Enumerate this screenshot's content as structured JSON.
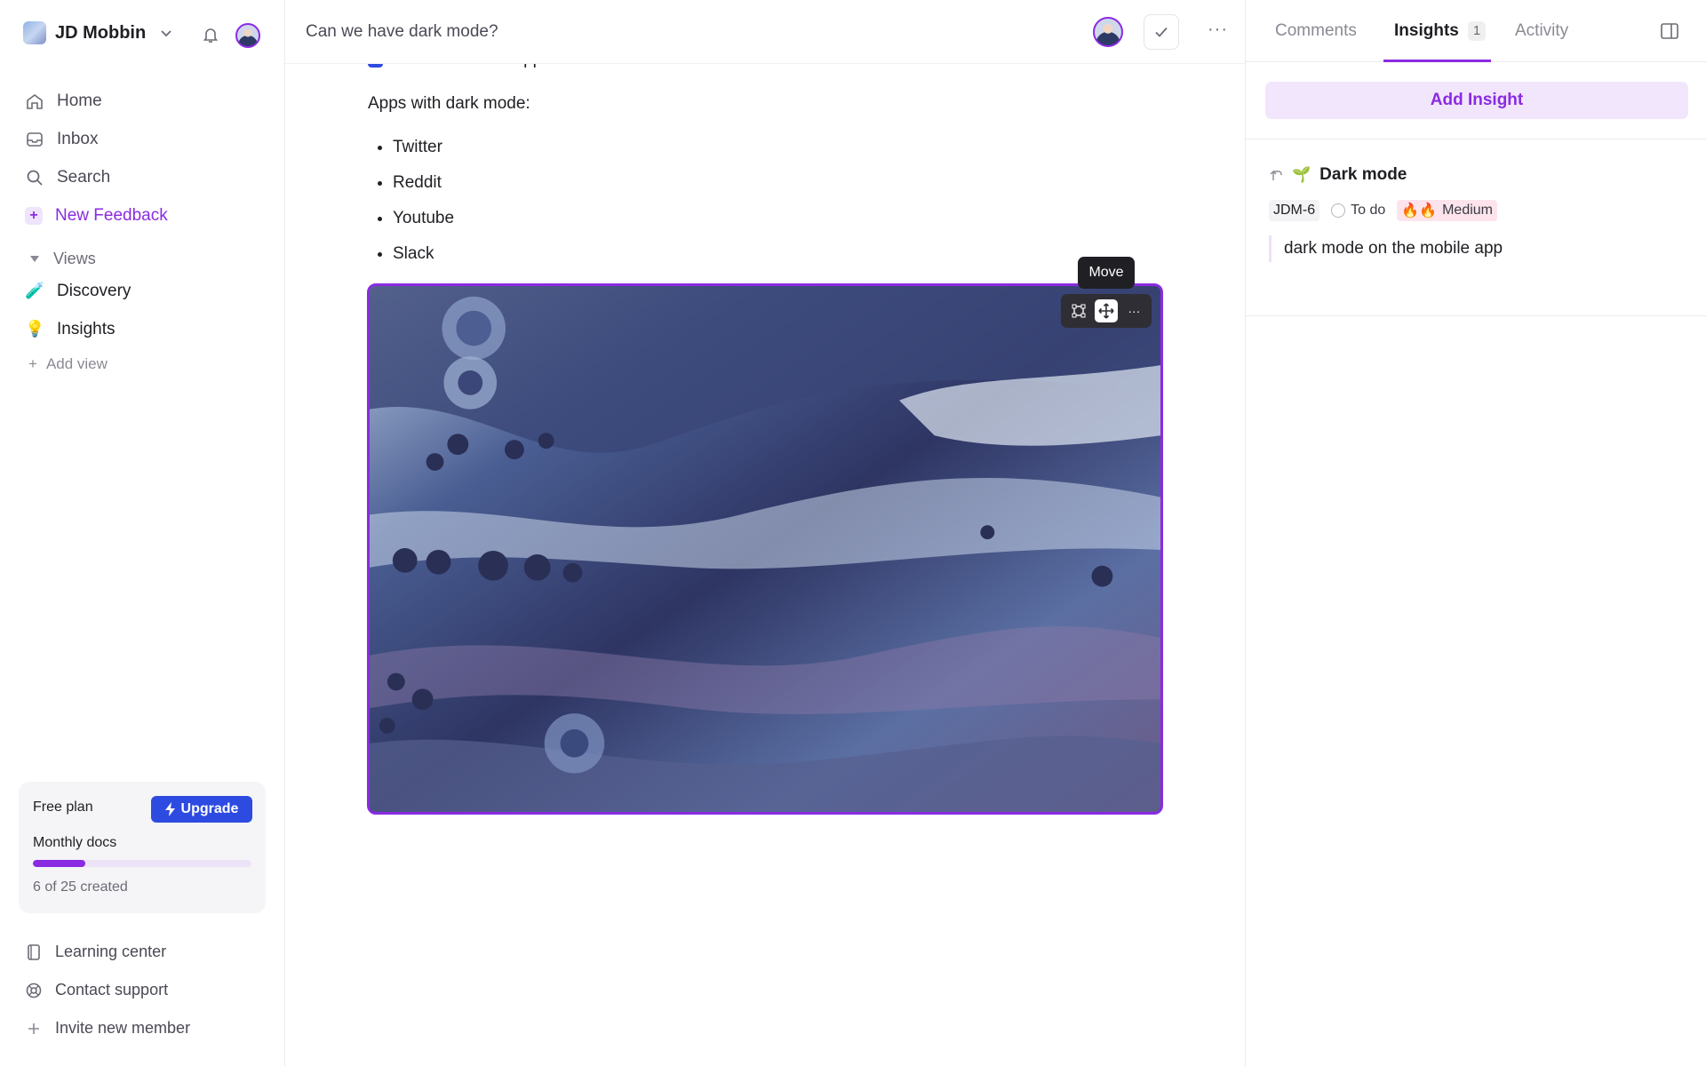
{
  "sidebar": {
    "workspace_name": "JD Mobbin",
    "nav": [
      {
        "label": "Home",
        "icon": "home-icon"
      },
      {
        "label": "Inbox",
        "icon": "inbox-icon"
      },
      {
        "label": "Search",
        "icon": "search-icon"
      },
      {
        "label": "New Feedback",
        "icon": "plus-icon"
      }
    ],
    "views_label": "Views",
    "views": [
      {
        "label": "Discovery",
        "icon": "test-tube-icon"
      },
      {
        "label": "Insights",
        "icon": "lightbulb-icon"
      }
    ],
    "add_view": "Add view",
    "plan": {
      "title": "Free plan",
      "upgrade": "Upgrade",
      "subtitle": "Monthly docs",
      "used": 6,
      "total": 25,
      "count_text": "6 of 25 created"
    },
    "footer": [
      {
        "label": "Learning center",
        "icon": "book-icon"
      },
      {
        "label": "Contact support",
        "icon": "lifebuoy-icon"
      },
      {
        "label": "Invite new member",
        "icon": "plus-icon"
      }
    ]
  },
  "main": {
    "doc_title": "Can we have dark mode?",
    "task_text": "Search for other apps with dark mode",
    "paragraph": "Apps with dark mode:",
    "apps": [
      "Twitter",
      "Reddit",
      "Youtube",
      "Slack"
    ],
    "tooltip": "Move"
  },
  "panel": {
    "tabs": [
      {
        "label": "Comments"
      },
      {
        "label": "Insights",
        "count": "1"
      },
      {
        "label": "Activity"
      }
    ],
    "add_insight": "Add Insight",
    "insight": {
      "title": "Dark mode",
      "id": "JDM-6",
      "status": "To do",
      "priority": "Medium",
      "priority_icon": "🔥🔥",
      "quote": "dark mode on the mobile app"
    }
  },
  "colors": {
    "accent": "#8a2be2",
    "upgrade_blue": "#2d4be0"
  }
}
